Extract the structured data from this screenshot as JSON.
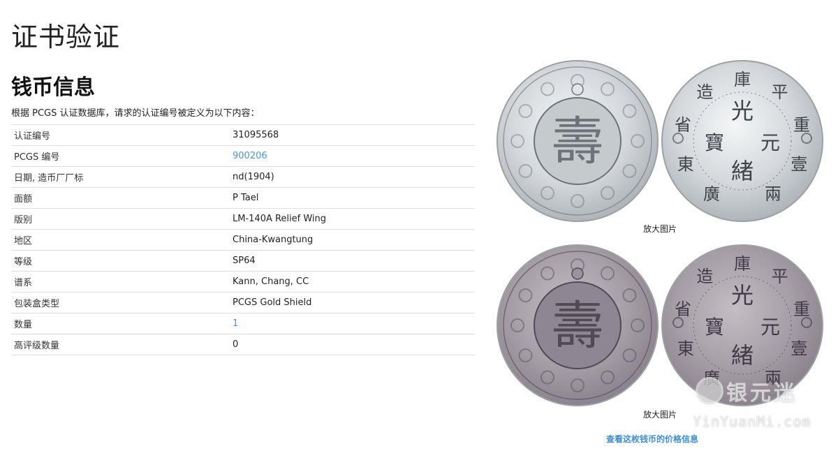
{
  "page": {
    "title": "证书验证",
    "section_title": "钱币信息",
    "intro": "根据 PCGS 认证数据库，请求的认证编号被定义为以下内容："
  },
  "details": [
    {
      "label": "认证编号",
      "value": "31095568",
      "is_link": false
    },
    {
      "label": "PCGS 编号",
      "value": "900206",
      "is_link": true
    },
    {
      "label": "日期, 造币厂厂标",
      "value": "nd(1904)",
      "is_link": false
    },
    {
      "label": "面额",
      "value": "P Tael",
      "is_link": false
    },
    {
      "label": "版别",
      "value": "LM-140A Relief Wing",
      "is_link": false
    },
    {
      "label": "地区",
      "value": "China-Kwangtung",
      "is_link": false
    },
    {
      "label": "等级",
      "value": "SP64",
      "is_link": false
    },
    {
      "label": "谱系",
      "value": "Kann, Chang, CC",
      "is_link": false
    },
    {
      "label": "包装盒类型",
      "value": "PCGS Gold Shield",
      "is_link": false
    },
    {
      "label": "数量",
      "value": "1",
      "is_link": true
    },
    {
      "label": "高评级数量",
      "value": "0",
      "is_link": false
    }
  ],
  "images": {
    "enlarge_label_1": "放大图片",
    "enlarge_label_2": "放大图片",
    "price_link": "查看这枚钱币的价格信息"
  },
  "coin_reverse": {
    "outer_chars": [
      "廣",
      "東",
      "省",
      "造",
      "庫",
      "平",
      "重",
      "壹",
      "兩"
    ],
    "center_top": "光",
    "center_bottom": "緒",
    "center_left": "寶",
    "center_right": "元"
  },
  "coin_obverse": {
    "center_char": "壽"
  },
  "watermark": {
    "cn": "银元迷",
    "en": "YinYuanMi.com"
  },
  "colors": {
    "link": "#4a98d0",
    "price_link": "#3d8fd0",
    "border": "#dddddd"
  }
}
